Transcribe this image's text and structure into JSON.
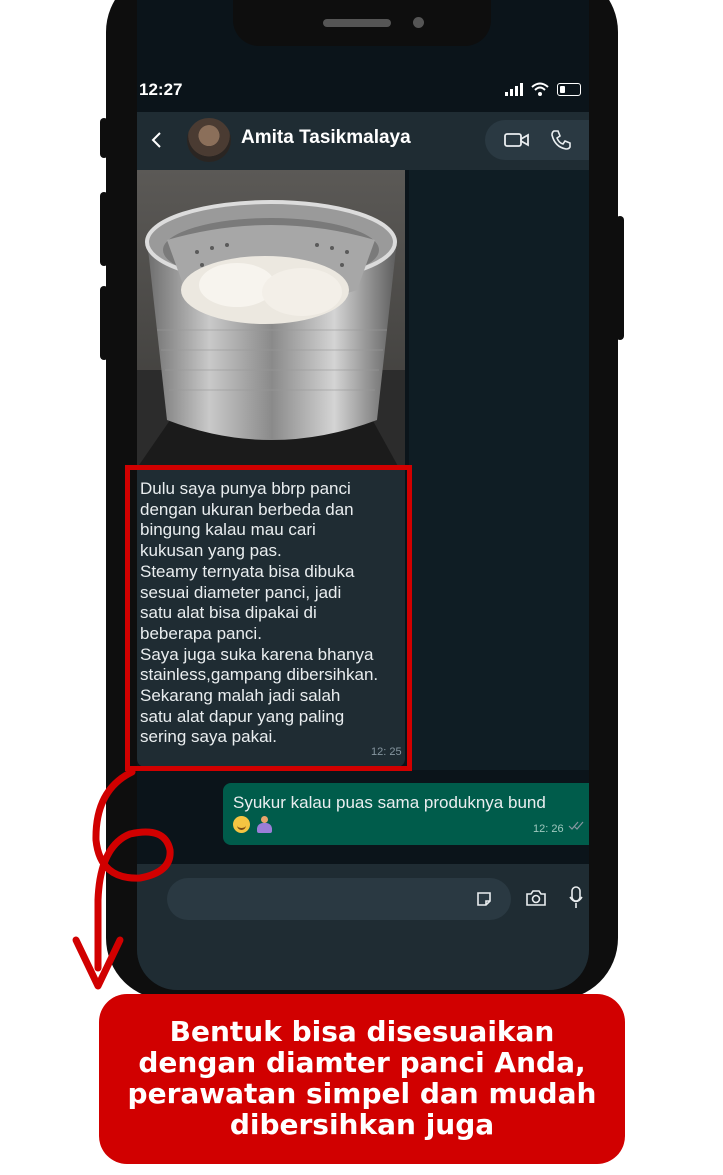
{
  "status_bar": {
    "time": "12:27"
  },
  "chat_header": {
    "contact_name": "Amita Tasikmalaya"
  },
  "messages": [
    {
      "direction": "incoming",
      "has_photo": true,
      "text": "Dulu saya punya bbrp panci\ndengan ukuran berbeda dan\nbingung kalau mau cari\nkukusan yang pas.\nSteamy ternyata bisa dibuka\nsesuai diameter panci, jadi\nsatu alat bisa dipakai di\nbeberapa panci.\nSaya juga suka karena bhanya\nstainless,gampang dibersihkan.\nSekarang malah jadi salah\nsatu alat dapur yang paling\nsering saya pakai.",
      "time": "12: 25"
    },
    {
      "direction": "outgoing",
      "text": "Syukur kalau puas sama produknya bund",
      "emoji": [
        "smiling-face-emoji",
        "folded-hands-emoji"
      ],
      "time": "12: 26"
    }
  ],
  "caption": {
    "text": "Bentuk bisa disesuaikan\ndengan diamter panci Anda,\nperawatan simpel dan mudah\ndibersihkan juga"
  },
  "colors": {
    "accent_red": "#d10000",
    "chat_bg": "#0b141a",
    "incoming_bubble": "#1f2c33",
    "outgoing_bubble": "#005c4b",
    "header_bg": "#1f2c33"
  },
  "icons": [
    "back-icon",
    "avatar",
    "video-call-icon",
    "voice-call-icon",
    "sticker-icon",
    "camera-icon",
    "mic-icon",
    "signal-icon",
    "wifi-icon",
    "battery-icon"
  ]
}
